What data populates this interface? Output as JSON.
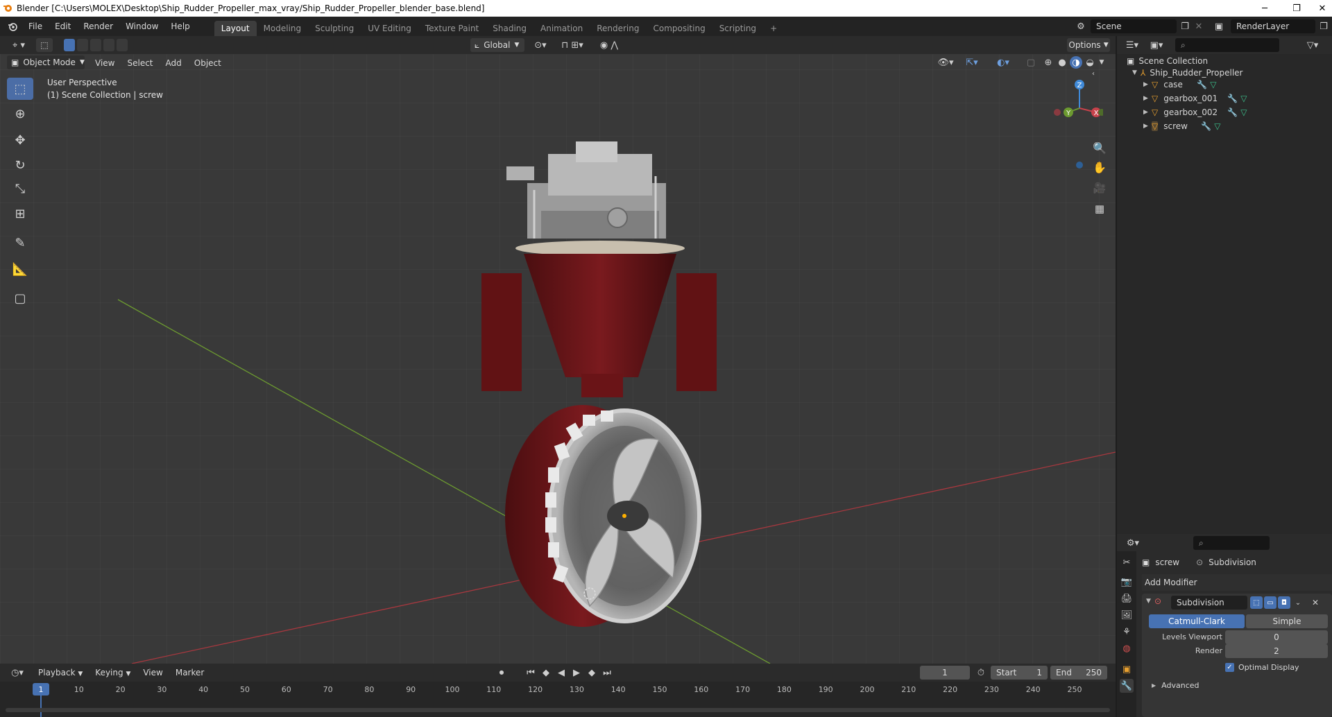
{
  "window": {
    "title": "Blender [C:\\Users\\MOLEX\\Desktop\\Ship_Rudder_Propeller_max_vray/Ship_Rudder_Propeller_blender_base.blend]",
    "minimize": "─",
    "restore": "❐",
    "close": "✕"
  },
  "menu": [
    "File",
    "Edit",
    "Render",
    "Window",
    "Help"
  ],
  "workspaces": [
    "Layout",
    "Modeling",
    "Sculpting",
    "UV Editing",
    "Texture Paint",
    "Shading",
    "Animation",
    "Rendering",
    "Compositing",
    "Scripting",
    "+"
  ],
  "scene": {
    "name": "Scene",
    "render_layer": "RenderLayer"
  },
  "toolbar": {
    "orientation": "Global",
    "options": "Options"
  },
  "viewport_header": {
    "mode": "Object Mode",
    "items": [
      "View",
      "Select",
      "Add",
      "Object"
    ]
  },
  "viewport": {
    "perspective": "User Perspective",
    "collection_info": "(1) Scene Collection | screw"
  },
  "gizmo": {
    "z": "Z",
    "y": "Y",
    "x": "X"
  },
  "outliner": {
    "root": "Scene Collection",
    "collection": "Ship_Rudder_Propeller",
    "objects": [
      "case",
      "gearbox_001",
      "gearbox_002",
      "screw"
    ]
  },
  "properties": {
    "object": "screw",
    "modifier_tab": "Subdivision",
    "add_modifier": "Add Modifier",
    "modifier_name": "Subdivision",
    "type_options": [
      "Catmull-Clark",
      "Simple"
    ],
    "levels_label": "Levels Viewport",
    "levels_value": "0",
    "render_label": "Render",
    "render_value": "2",
    "optimal_display": "Optimal Display",
    "advanced": "Advanced"
  },
  "timeline": {
    "menu": [
      "Playback",
      "Keying",
      "View",
      "Marker"
    ],
    "current_frame": "1",
    "start_label": "Start",
    "start": "1",
    "end_label": "End",
    "end": "250",
    "ticks": [
      "1",
      "10",
      "20",
      "30",
      "40",
      "50",
      "60",
      "70",
      "80",
      "90",
      "100",
      "110",
      "120",
      "130",
      "140",
      "150",
      "160",
      "170",
      "180",
      "190",
      "200",
      "210",
      "220",
      "230",
      "240",
      "250"
    ]
  },
  "colors": {
    "accent": "#4772b3",
    "active_tool": "#4b6da6",
    "x_axis": "#c8424b",
    "y_axis": "#6c9a30",
    "z_axis": "#3f8ad9",
    "hull_red": "#6b1518"
  }
}
